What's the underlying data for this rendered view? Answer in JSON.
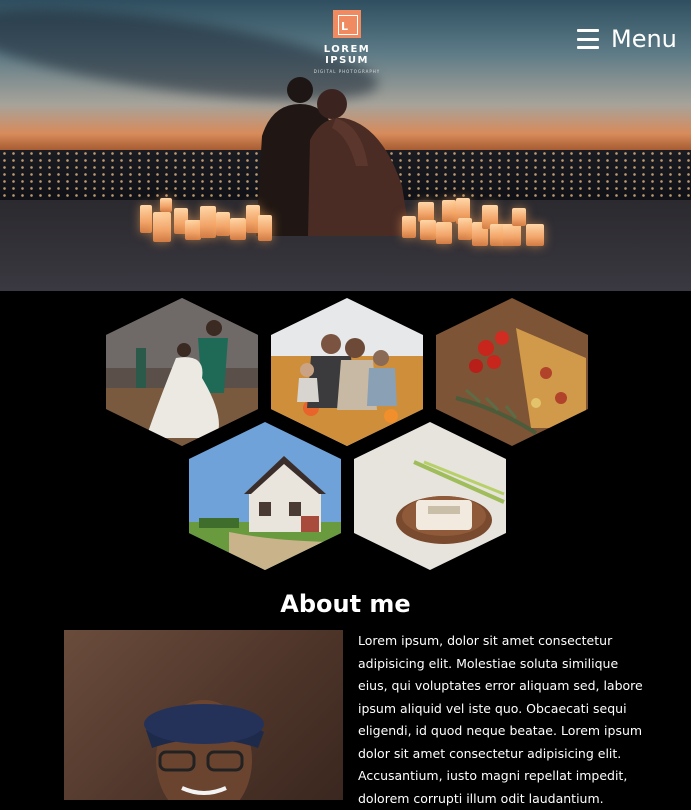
{
  "header": {
    "logo_text": "LOREM IPSUM",
    "logo_subtext": "DIGITAL PHOTOGRAPHY",
    "logo_mark": "L",
    "menu_label": "Menu",
    "menu_icon": "hamburger-icon",
    "accent_color": "#f08a60"
  },
  "gallery": {
    "items": [
      {
        "subject": "wedding-dance",
        "icon": "photo"
      },
      {
        "subject": "family-in-field",
        "icon": "photo"
      },
      {
        "subject": "pizza-and-tomatoes",
        "icon": "photo"
      },
      {
        "subject": "house",
        "icon": "photo"
      },
      {
        "subject": "soap-product",
        "icon": "photo"
      }
    ]
  },
  "about": {
    "title": "About me",
    "text": "Lorem ipsum, dolor sit amet consectetur adipisicing elit. Molestiae soluta similique eius, qui voluptates error aliquam sed, labore ipsum aliquid vel iste quo. Obcaecati sequi eligendi, id quod neque beatae. Lorem ipsum dolor sit amet consectetur adipisicing elit. Accusantium, iusto magni repellat impedit, dolorem corrupti illum odit laudantium."
  }
}
